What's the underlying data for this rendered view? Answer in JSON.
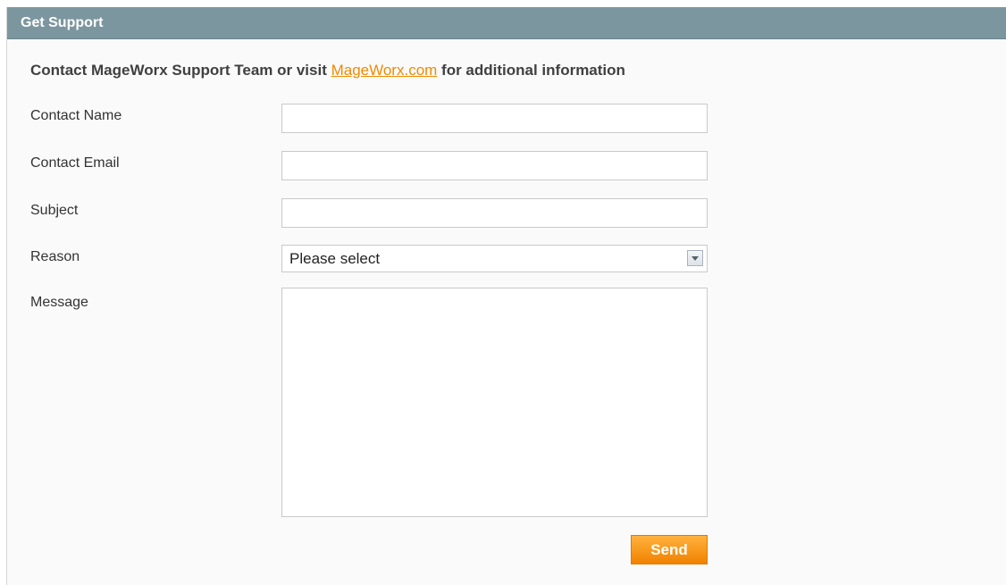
{
  "panel": {
    "title": "Get Support"
  },
  "intro": {
    "prefix": "Contact MageWorx Support Team or visit ",
    "link_text": "MageWorx.com",
    "suffix": " for additional information"
  },
  "form": {
    "contact_name_label": "Contact Name",
    "contact_name_value": "",
    "contact_email_label": "Contact Email",
    "contact_email_value": "",
    "subject_label": "Subject",
    "subject_value": "",
    "reason_label": "Reason",
    "reason_selected": "Please select",
    "message_label": "Message",
    "message_value": "",
    "send_label": "Send"
  },
  "colors": {
    "header_bg": "#7c969f",
    "link": "#f08a00",
    "send_button": "#f18200"
  },
  "icons": {
    "reason_dropdown": "chevron-down-icon"
  }
}
